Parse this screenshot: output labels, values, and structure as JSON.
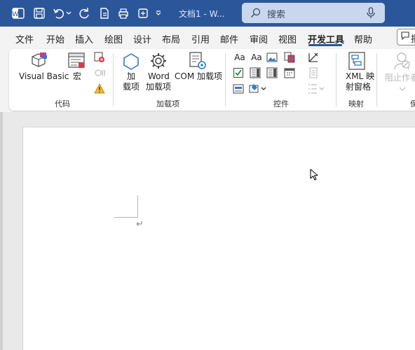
{
  "titlebar": {
    "doc_title": "文档1 - W...",
    "search_placeholder": "搜索",
    "background": "#2b579a"
  },
  "menu": {
    "tabs": [
      "文件",
      "开始",
      "插入",
      "绘图",
      "设计",
      "布局",
      "引用",
      "邮件",
      "审阅",
      "视图",
      "开发工具",
      "帮助"
    ],
    "active_tab": "开发工具",
    "comment_button": "批"
  },
  "ribbon": {
    "groups": {
      "code": "代码",
      "addins": "加载项",
      "controls": "控件",
      "mapping": "映射",
      "protect": "保"
    },
    "buttons": {
      "visual_basic": "Visual Basic",
      "macros": "宏",
      "addin_1": "加",
      "addin_2": "载项",
      "word_addin_1": "Word",
      "word_addin_2": "加载项",
      "com_addin": "COM 加载项",
      "xml_1": "XML 映",
      "xml_2": "射窗格",
      "block_authors": "阻止作者"
    },
    "control_glyphs": {
      "aa": "Aa"
    }
  },
  "document": {
    "paragraph_mark": "↵"
  }
}
